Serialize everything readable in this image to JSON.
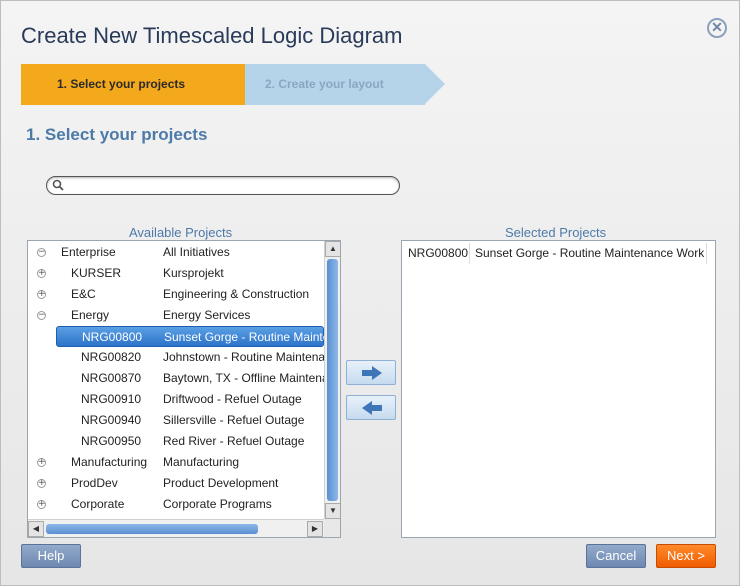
{
  "dialog": {
    "title": "Create New Timescaled Logic Diagram"
  },
  "wizard": {
    "step1": "1. Select your projects",
    "step2": "2. Create your layout"
  },
  "section_title": "1. Select your projects",
  "search": {
    "value": "",
    "placeholder": ""
  },
  "available": {
    "label": "Available Projects",
    "rows": [
      {
        "code": "Enterprise",
        "name": "All Initiatives",
        "expander": "minus"
      },
      {
        "code": "KURSER",
        "name": "Kursprojekt",
        "expander": "plus"
      },
      {
        "code": "E&C",
        "name": "Engineering & Construction",
        "expander": "plus"
      },
      {
        "code": "Energy",
        "name": "Energy Services",
        "expander": "minus"
      },
      {
        "code": "NRG00800",
        "name": "Sunset Gorge - Routine Maintenance Work",
        "selected": true
      },
      {
        "code": "NRG00820",
        "name": "Johnstown - Routine Maintenance"
      },
      {
        "code": "NRG00870",
        "name": "Baytown, TX - Offline Maintenance"
      },
      {
        "code": "NRG00910",
        "name": "Driftwood - Refuel Outage"
      },
      {
        "code": "NRG00940",
        "name": "Sillersville - Refuel Outage"
      },
      {
        "code": "NRG00950",
        "name": "Red River - Refuel Outage"
      },
      {
        "code": "Manufacturing",
        "name": "Manufacturing",
        "expander": "plus"
      },
      {
        "code": "ProdDev",
        "name": "Product Development",
        "expander": "plus"
      },
      {
        "code": "Corporate",
        "name": "Corporate Programs",
        "expander": "plus"
      }
    ]
  },
  "selected": {
    "label": "Selected Projects",
    "rows": [
      {
        "code": "NRG00800",
        "name": "Sunset Gorge - Routine Maintenance Work"
      }
    ]
  },
  "buttons": {
    "help": "Help",
    "cancel": "Cancel",
    "next": "Next >"
  },
  "icons": {
    "close": "close-icon",
    "search": "search-icon",
    "add": "arrow-right-icon",
    "remove": "arrow-left-icon"
  },
  "colors": {
    "accent": "#f4a81c",
    "next": "#ef5c00",
    "heading": "#4d7aa8",
    "selection": "#2d73c9"
  }
}
